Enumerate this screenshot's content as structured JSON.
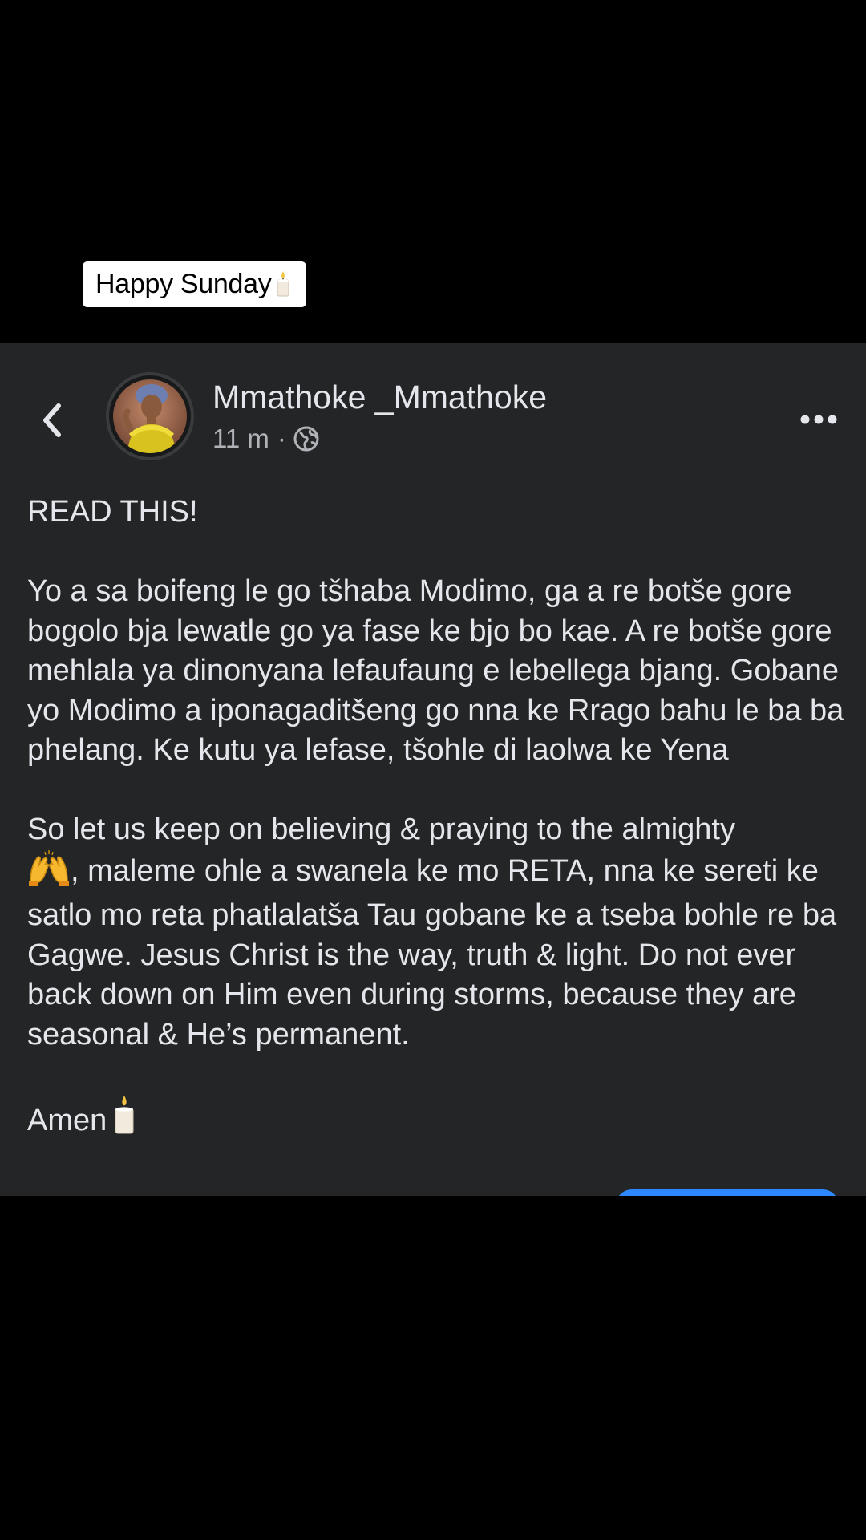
{
  "caption": {
    "text": "Happy Sunday",
    "icon": "candle-icon"
  },
  "post": {
    "author_name": "Mmathoke _Mmathoke",
    "timestamp": "11 m",
    "separator": "·",
    "privacy_icon": "globe-icon",
    "back_icon": "chevron-left-icon",
    "more_icon": "more-horizontal-icon",
    "paragraphs": {
      "p1": "READ THIS!",
      "p2": "Yo a sa boifeng le go tšhaba Modimo, ga a re botše gore bogolo bja lewatle go ya fase ke bjo bo kae. A re botše gore mehlala ya dinonyana lefaufaung e lebellega bjang. Gobane yo Modimo a iponagaditšeng go nna ke Rrago bahu le ba ba phelang. Ke kutu ya lefase, tšohle di laolwa ke Yena",
      "p3_intro": "So let us keep on believing & praying to the almighty",
      "p3_emoji": "🙌",
      "p3_rest": ", maleme ohle a swanela ke mo RETA, nna ke sereti ke satlo mo reta phatlalatša Tau gobane ke a tseba bohle re ba Gagwe. Jesus Christ is the way, truth & light. Do not ever back down on Him even during storms, because they are seasonal & He’s permanent.",
      "p4": "Amen"
    }
  },
  "colors": {
    "background": "#000000",
    "post_background": "#242526",
    "primary_text": "#e4e6eb",
    "secondary_text": "#b0b3b8",
    "accent_blue": "#2d88ff",
    "caption_background": "#ffffff"
  }
}
